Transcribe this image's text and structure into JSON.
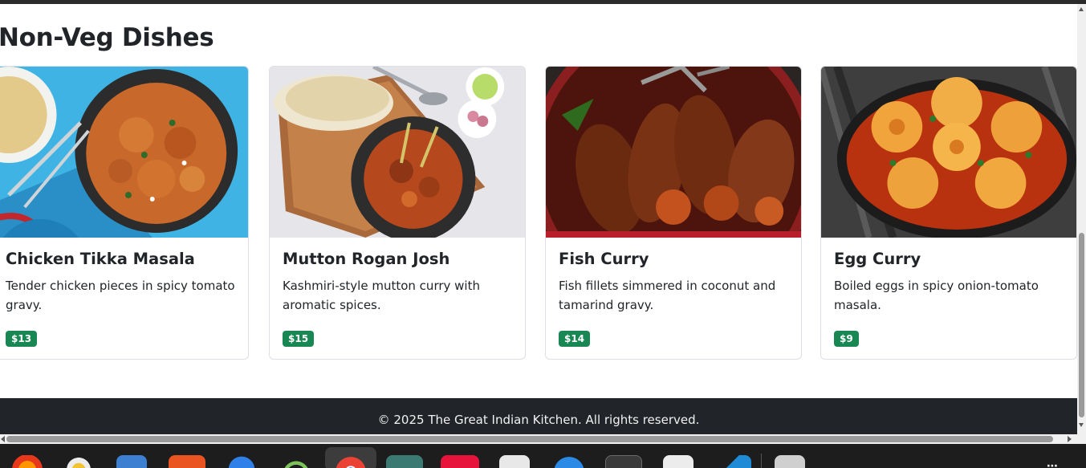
{
  "section": {
    "title": "Non-Veg Dishes"
  },
  "dishes": [
    {
      "name": "Chicken Tikka Masala",
      "description": "Tender chicken pieces in spicy tomato gravy.",
      "price": "$13"
    },
    {
      "name": "Mutton Rogan Josh",
      "description": "Kashmiri-style mutton curry with aromatic spices.",
      "price": "$15"
    },
    {
      "name": "Fish Curry",
      "description": "Fish fillets simmered in coconut and tamarind gravy.",
      "price": "$14"
    },
    {
      "name": "Egg Curry",
      "description": "Boiled eggs in spicy onion-tomato masala.",
      "price": "$9"
    }
  ],
  "footer": {
    "copyright": "© 2025 The Great Indian Kitchen. All rights reserved."
  },
  "dock_icons": [
    "firefox-icon",
    "rhythmbox-icon",
    "files-icon",
    "app-center-icon",
    "thunderbird-icon",
    "android-studio-icon",
    "chrome-icon",
    "file-manager-icon",
    "app-icon",
    "text-editor-icon",
    "help-icon",
    "terminal-icon",
    "document-viewer-icon",
    "vscode-icon",
    "disk-icon",
    "show-apps-icon"
  ],
  "colors": {
    "price_badge": "#198754",
    "footer_bg": "#212529",
    "text": "#212529"
  }
}
